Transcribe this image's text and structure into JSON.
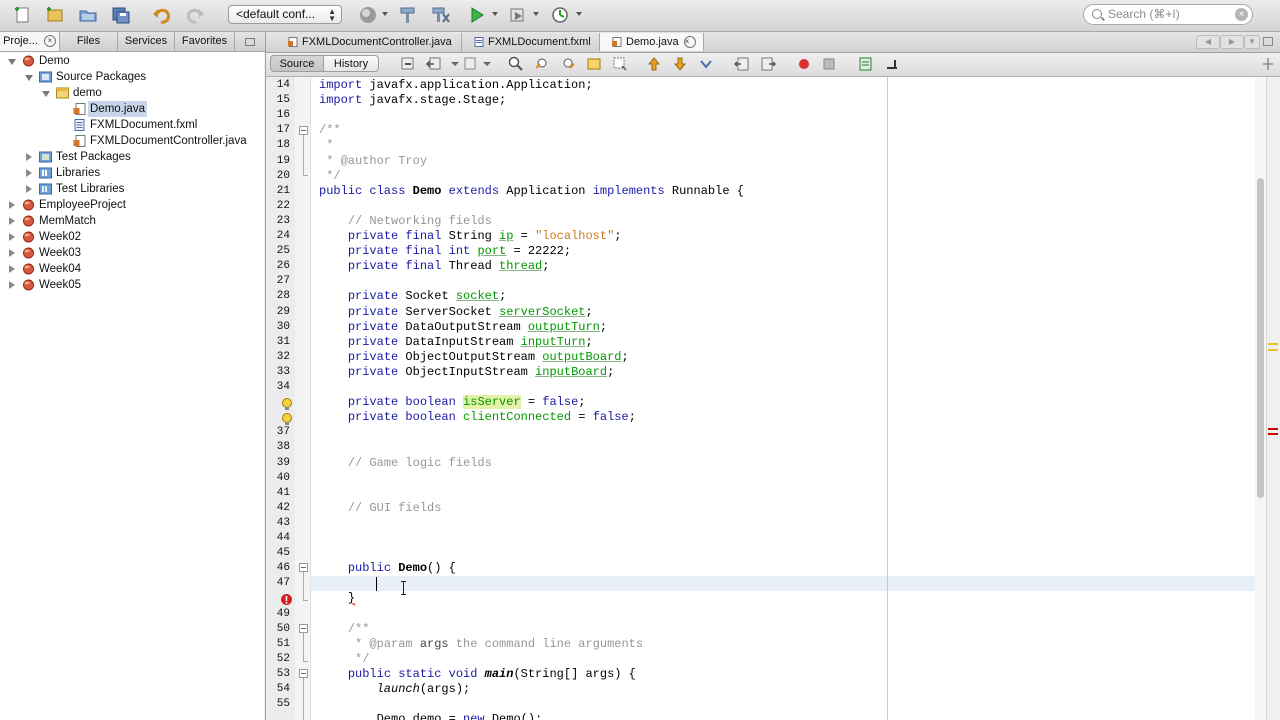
{
  "toolbar": {
    "config_value": "<default conf...",
    "search_placeholder": "Search (⌘+I)",
    "icons": [
      "new-file-icon",
      "new-project-icon",
      "open-project-icon",
      "save-all-icon",
      "undo-icon",
      "redo-icon",
      "globe-icon",
      "hammer-icon",
      "clean-build-icon",
      "run-icon",
      "debug-icon",
      "profile-icon"
    ]
  },
  "left_panel": {
    "tabs": [
      "Proje...",
      "Files",
      "Services",
      "Favorites"
    ],
    "tree": [
      {
        "label": "Demo",
        "depth": 0,
        "expanded": true,
        "icon": "project-icon"
      },
      {
        "label": "Source Packages",
        "depth": 1,
        "expanded": true,
        "icon": "source-packages-icon"
      },
      {
        "label": "demo",
        "depth": 2,
        "expanded": true,
        "icon": "package-icon"
      },
      {
        "label": "Demo.java",
        "depth": 3,
        "selected": true,
        "icon": "java-file-icon"
      },
      {
        "label": "FXMLDocument.fxml",
        "depth": 3,
        "icon": "fxml-file-icon"
      },
      {
        "label": "FXMLDocumentController.java",
        "depth": 3,
        "icon": "java-file-icon"
      },
      {
        "label": "Test Packages",
        "depth": 1,
        "expanded": false,
        "icon": "test-packages-icon"
      },
      {
        "label": "Libraries",
        "depth": 1,
        "expanded": false,
        "icon": "libraries-icon"
      },
      {
        "label": "Test Libraries",
        "depth": 1,
        "expanded": false,
        "icon": "test-libraries-icon"
      },
      {
        "label": "EmployeeProject",
        "depth": 0,
        "expanded": false,
        "icon": "project-icon"
      },
      {
        "label": "MemMatch",
        "depth": 0,
        "expanded": false,
        "icon": "project-icon"
      },
      {
        "label": "Week02",
        "depth": 0,
        "expanded": false,
        "icon": "project-icon"
      },
      {
        "label": "Week03",
        "depth": 0,
        "expanded": false,
        "icon": "project-icon"
      },
      {
        "label": "Week04",
        "depth": 0,
        "expanded": false,
        "icon": "project-icon"
      },
      {
        "label": "Week05",
        "depth": 0,
        "expanded": false,
        "icon": "project-icon"
      }
    ]
  },
  "editor": {
    "tabs": [
      {
        "label": "FXMLDocumentController.java",
        "active": false
      },
      {
        "label": "FXMLDocument.fxml",
        "active": false
      },
      {
        "label": "Demo.java",
        "active": true
      }
    ],
    "view_modes": {
      "source": "Source",
      "history": "History"
    },
    "current_line": 47,
    "error_line": 48,
    "warning_lines": [
      35,
      36
    ],
    "lines": [
      {
        "n": "14",
        "html": "<span class=\"kw\">import</span> javafx.application.Application;"
      },
      {
        "n": "15",
        "html": "<span class=\"kw\">import</span> javafx.stage.Stage;"
      },
      {
        "n": "16",
        "html": ""
      },
      {
        "n": "17",
        "html": "<span class=\"cm\">/**</span>"
      },
      {
        "n": "18",
        "html": "<span class=\"cm\"> *</span>"
      },
      {
        "n": "19",
        "html": "<span class=\"cm\"> * @author Troy</span>"
      },
      {
        "n": "20",
        "html": "<span class=\"cm\"> */</span>"
      },
      {
        "n": "21",
        "html": "<span class=\"kw\">public class</span> <span class=\"b\">Demo</span> <span class=\"kw\">extends</span> Application <span class=\"kw\">implements</span> Runnable {"
      },
      {
        "n": "22",
        "html": ""
      },
      {
        "n": "23",
        "html": "    <span class=\"cm\">// Networking fields</span>"
      },
      {
        "n": "24",
        "html": "    <span class=\"kw\">private final</span> String <span class=\"fld\">ip</span> = <span class=\"str\">\"localhost\"</span>;"
      },
      {
        "n": "25",
        "html": "    <span class=\"kw\">private final int</span> <span class=\"fld\">port</span> = 22222;"
      },
      {
        "n": "26",
        "html": "    <span class=\"kw\">private final</span> Thread <span class=\"fld\">thread</span>;"
      },
      {
        "n": "27",
        "html": ""
      },
      {
        "n": "28",
        "html": "    <span class=\"kw\">private</span> Socket <span class=\"fld\">socket</span>;"
      },
      {
        "n": "29",
        "html": "    <span class=\"kw\">private</span> ServerSocket <span class=\"fld\">serverSocket</span>;"
      },
      {
        "n": "30",
        "html": "    <span class=\"kw\">private</span> DataOutputStream <span class=\"fld\">outputTurn</span>;"
      },
      {
        "n": "31",
        "html": "    <span class=\"kw\">private</span> DataInputStream <span class=\"fld\">inputTurn</span>;"
      },
      {
        "n": "32",
        "html": "    <span class=\"kw\">private</span> ObjectOutputStream <span class=\"fld\">outputBoard</span>;"
      },
      {
        "n": "33",
        "html": "    <span class=\"kw\">private</span> ObjectInputStream <span class=\"fld\">inputBoard</span>;"
      },
      {
        "n": "34",
        "html": ""
      },
      {
        "n": "",
        "html": "    <span class=\"kw\">private boolean</span> <span class=\"fldhl\">isServer</span> = <span class=\"kw\">false</span>;"
      },
      {
        "n": "",
        "html": "    <span class=\"kw\">private boolean</span> <span class=\"fld\" style=\"text-decoration:none\">clientConnected</span> = <span class=\"kw\">false</span>;"
      },
      {
        "n": "37",
        "html": ""
      },
      {
        "n": "38",
        "html": ""
      },
      {
        "n": "39",
        "html": "    <span class=\"cm\">// Game logic fields</span>"
      },
      {
        "n": "40",
        "html": ""
      },
      {
        "n": "41",
        "html": ""
      },
      {
        "n": "42",
        "html": "    <span class=\"cm\">// GUI fields</span>"
      },
      {
        "n": "43",
        "html": ""
      },
      {
        "n": "44",
        "html": ""
      },
      {
        "n": "45",
        "html": ""
      },
      {
        "n": "46",
        "html": "    <span class=\"kw\">public</span> <span class=\"b\">Demo</span>() {"
      },
      {
        "n": "47",
        "html": ""
      },
      {
        "n": "",
        "html": "    <span style=\"text-decoration:underline wavy #d00\">}</span>"
      },
      {
        "n": "49",
        "html": ""
      },
      {
        "n": "50",
        "html": "    <span class=\"cm\">/**</span>"
      },
      {
        "n": "51",
        "html": "    <span class=\"cm\"> * @param <span style=\"color:#444\">args</span> the command line arguments</span>"
      },
      {
        "n": "52",
        "html": "    <span class=\"cm\"> */</span>"
      },
      {
        "n": "53",
        "html": "    <span class=\"kw\">public static void</span> <span class=\"b i\">main</span>(String[] args) {"
      },
      {
        "n": "54",
        "html": "        <span class=\"i\">launch</span>(args);"
      },
      {
        "n": "55",
        "html": ""
      },
      {
        "n": "",
        "html": "        Demo demo = <span class=\"kw\">new</span> Demo();"
      }
    ]
  },
  "colors": {
    "keyword": "#1a1aa6",
    "string": "#cf7b1c",
    "comment": "#969696",
    "field": "#009900",
    "current_line": "#e9eff8",
    "margin_line": "#f3b7b7",
    "error": "#d00000",
    "warning": "#f0c020"
  }
}
